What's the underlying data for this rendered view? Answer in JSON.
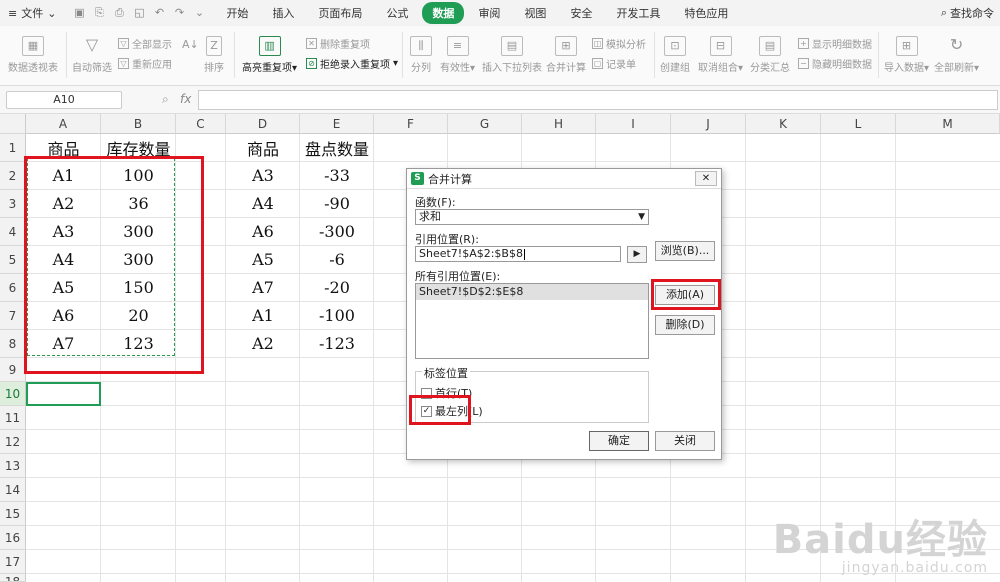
{
  "menu": {
    "file": "文件",
    "tabs": [
      "开始",
      "插入",
      "页面布局",
      "公式",
      "数据",
      "审阅",
      "视图",
      "安全",
      "开发工具",
      "特色应用"
    ],
    "active_tab": "数据",
    "search": "查找命令"
  },
  "ribbon": {
    "pivot": "数据透视表",
    "autofilter": "自动筛选",
    "show_all": "全部显示",
    "reapply": "重新应用",
    "sort": "排序",
    "highlight_dup": "高亮重复项",
    "remove_dup": "删除重复项",
    "reject_dup": "拒绝录入重复项",
    "split": "分列",
    "validity": "有效性",
    "dropdown": "插入下拉列表",
    "consolidate": "合并计算",
    "simulate": "模拟分析",
    "record": "记录单",
    "create_group": "创建组",
    "ungroup": "取消组合",
    "subtotal": "分类汇总",
    "show_detail": "显示明细数据",
    "hide_detail": "隐藏明细数据",
    "import": "导入数据",
    "refresh_all": "全部刷新"
  },
  "formula_bar": {
    "name_box": "A10",
    "fx": "fx",
    "content": ""
  },
  "columns": [
    "A",
    "B",
    "C",
    "D",
    "E",
    "F",
    "G",
    "H",
    "I",
    "J",
    "K",
    "L",
    "M"
  ],
  "rows": [
    "1",
    "2",
    "3",
    "4",
    "5",
    "6",
    "7",
    "8",
    "9",
    "10",
    "11",
    "12",
    "13",
    "14",
    "15",
    "16",
    "17",
    "18"
  ],
  "table1": {
    "header": [
      "商品",
      "库存数量"
    ],
    "rows": [
      [
        "A1",
        "100"
      ],
      [
        "A2",
        "36"
      ],
      [
        "A3",
        "300"
      ],
      [
        "A4",
        "300"
      ],
      [
        "A5",
        "150"
      ],
      [
        "A6",
        "20"
      ],
      [
        "A7",
        "123"
      ]
    ]
  },
  "table2": {
    "header": [
      "商品",
      "盘点数量"
    ],
    "rows": [
      [
        "A3",
        "-33"
      ],
      [
        "A4",
        "-90"
      ],
      [
        "A6",
        "-300"
      ],
      [
        "A5",
        "-6"
      ],
      [
        "A7",
        "-20"
      ],
      [
        "A1",
        "-100"
      ],
      [
        "A2",
        "-123"
      ]
    ]
  },
  "dialog": {
    "title": "合并计算",
    "function_label": "函数(F):",
    "function_value": "求和",
    "ref_label": "引用位置(R):",
    "ref_value": "Sheet7!$A$2:$B$8",
    "browse": "浏览(B)...",
    "all_refs_label": "所有引用位置(E):",
    "all_refs": [
      "Sheet7!$D$2:$E$8"
    ],
    "add": "添加(A)",
    "delete": "删除(D)",
    "label_group": "标签位置",
    "top_row": "首行(T)",
    "top_row_checked": false,
    "left_col": "最左列(L)",
    "left_col_checked": true,
    "ok": "确定",
    "close": "关闭"
  },
  "watermark": {
    "logo": "Baidu经验",
    "url": "jingyan.baidu.com"
  }
}
